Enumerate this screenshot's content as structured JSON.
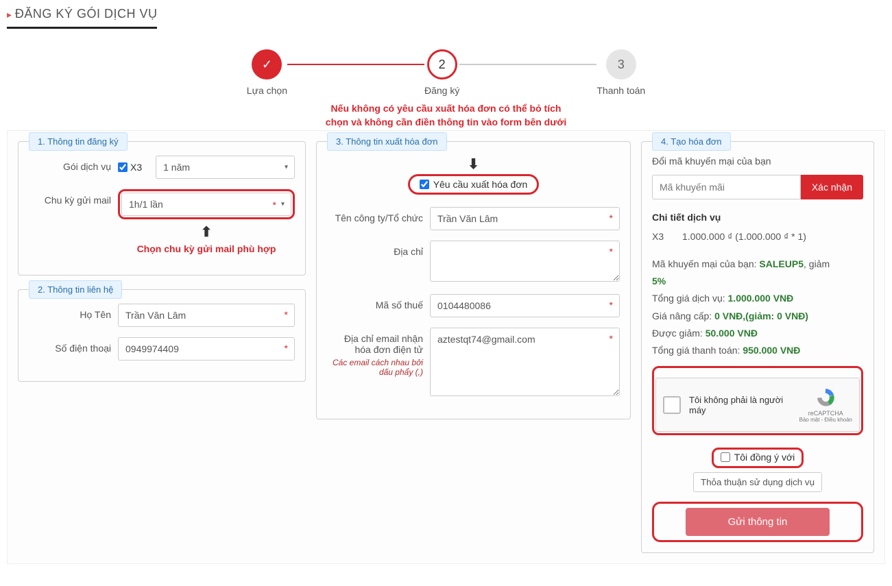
{
  "title": "ĐĂNG KÝ GÓI DỊCH VỤ",
  "progress": {
    "step1": "Lựa chọn",
    "step2_num": "2",
    "step2": "Đăng ký",
    "step3_num": "3",
    "step3": "Thanh toán"
  },
  "notes": {
    "line1": "Nếu không có yêu cầu xuất hóa đơn có thể bỏ tích",
    "line2": "chọn và không cần điền thông tin vào form bên dưới",
    "mail_cycle": "Chọn chu kỳ gửi mail phù hợp"
  },
  "panel1": {
    "title": "1. Thông tin đăng ký",
    "pkg_label": "Gói dịch vụ",
    "pkg_code": "X3",
    "duration": "1 năm",
    "cycle_label": "Chu kỳ gửi mail",
    "cycle_value": "1h/1 lần"
  },
  "panel2": {
    "title": "2. Thông tin liên hệ",
    "name_label": "Họ Tên",
    "name_value": "Trần Văn Lâm",
    "phone_label": "Số điện thoại",
    "phone_value": "0949974409"
  },
  "panel3": {
    "title": "3. Thông tin xuất hóa đơn",
    "req_label": "Yêu cầu xuất hóa đơn",
    "company_label": "Tên công ty/Tổ chức",
    "company_value": "Trần Văn Lâm",
    "addr_label": "Địa chỉ",
    "addr_value": "",
    "tax_label": "Mã số thuế",
    "tax_value": "0104480086",
    "email_label": "Địa chỉ email nhận hóa đơn điện tử",
    "email_hint": "Các email cách nhau bởi dấu phẩy (,)",
    "email_value": "aztestqt74@gmail.com"
  },
  "panel4": {
    "title": "4. Tạo hóa đơn",
    "promo_label": "Đổi mã khuyến mại của bạn",
    "promo_placeholder": "Mã khuyến mãi",
    "promo_btn": "Xác nhận",
    "detail_title": "Chi tiết dịch vụ",
    "detail_code": "X3",
    "detail_price": "1.000.000 ₫ (1.000.000 ₫ * 1)",
    "summary": {
      "promo_prefix": "Mã khuyến mại của bạn: ",
      "promo_code": "SALEUP5",
      "promo_suffix": ", giảm ",
      "promo_pct": "5%",
      "total_label": "Tổng giá dịch vụ: ",
      "total_value": "1.000.000 VNĐ",
      "upgrade_label": "Giá nâng cấp: ",
      "upgrade_value": "0 VNĐ,(giảm: 0 VNĐ)",
      "discount_label": "Được giảm: ",
      "discount_value": "50.000 VNĐ",
      "pay_label": "Tổng giá thanh toán: ",
      "pay_value": "950.000 VNĐ"
    },
    "recaptcha": {
      "text": "Tôi không phải là người máy",
      "brand": "reCAPTCHA",
      "sub": "Bảo mật - Điều khoản"
    },
    "agree": "Tôi đồng ý với",
    "tos": "Thỏa thuận sử dụng dịch vụ",
    "submit": "Gửi thông tin"
  }
}
